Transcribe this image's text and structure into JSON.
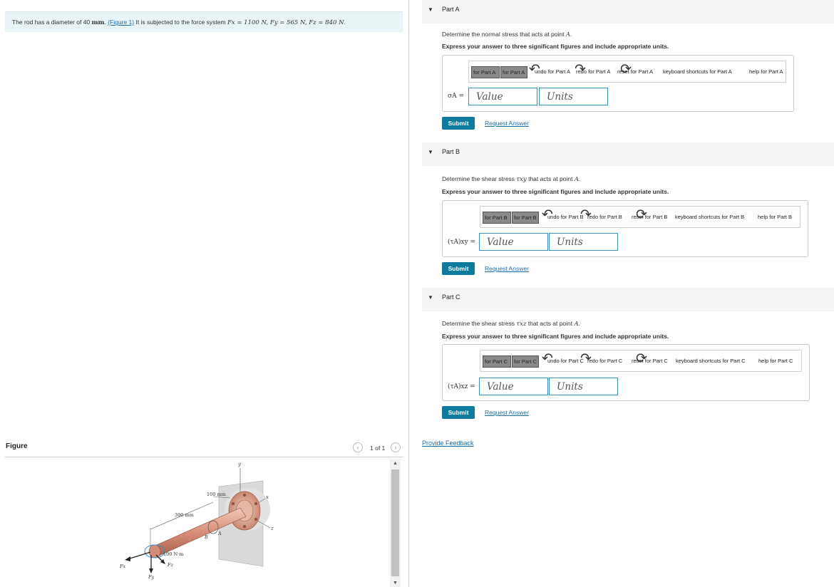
{
  "problem": {
    "text_before": "The rod has a diameter of 40 ",
    "unit": "mm",
    "text_period": ". ",
    "figure_link": "(Figure 1)",
    "text_after": " It is subjected to the force system ",
    "forces": "Fx = 1100 N, Fy = 565 N, Fz = 840 N",
    "end": "."
  },
  "figure_panel": {
    "title": "Figure",
    "prev_icon": "‹",
    "next_icon": "›",
    "page_count": "1 of 1",
    "scroll_up": "▲",
    "scroll_down": "▼",
    "labels": {
      "dim_100": "100 mm",
      "dim_300": "300 mm",
      "moment": "100 N·m",
      "y_axis": "y",
      "x_axis": "x",
      "z_axis": "z",
      "point_a": "A",
      "point_b": "B",
      "fx": "Fx",
      "fy": "Fy",
      "fz": "Fz"
    }
  },
  "parts": [
    {
      "title": "Part A",
      "caret": "▼",
      "question_before": "Determine the normal stress that acts at point ",
      "question_point": "A",
      "question_after": ".",
      "instruction": "Express your answer to three significant figures and include appropriate units.",
      "toolbar": {
        "btn1": "for Part A",
        "btn2": "for Part A",
        "undo": "undo for Part A",
        "redo": "redo for Part A",
        "reset": "reset for Part A",
        "keyboard": "keyboard shortcuts for Part A",
        "help": "help for Part A"
      },
      "label": "σA =",
      "value_placeholder": "Value",
      "units_placeholder": "Units",
      "submit": "Submit",
      "request": "Request Answer"
    },
    {
      "title": "Part B",
      "caret": "▼",
      "question_before": "Determine the shear stress ",
      "question_symbol": "τxy",
      "question_mid": " that acts at point ",
      "question_point": "A",
      "question_after": ".",
      "instruction": "Express your answer to three significant figures and include appropriate units.",
      "toolbar": {
        "btn1": "for Part B",
        "btn2": "for Part B",
        "undo": "undo for Part B",
        "redo": "redo for Part B",
        "reset": "reset for Part B",
        "keyboard": "keyboard shortcuts for Part B",
        "help": "help for Part B"
      },
      "label": "(τA)xy =",
      "value_placeholder": "Value",
      "units_placeholder": "Units",
      "submit": "Submit",
      "request": "Request Answer"
    },
    {
      "title": "Part C",
      "caret": "▼",
      "question_before": "Determine the shear stress ",
      "question_symbol": "τxz",
      "question_mid": " that acts at point ",
      "question_point": "A",
      "question_after": ".",
      "instruction": "Express your answer to three significant figures and include appropriate units.",
      "toolbar": {
        "btn1": "for Part C",
        "btn2": "for Part C",
        "undo": "undo for Part C",
        "redo": "redo for Part C",
        "reset": "reset for Part C",
        "keyboard": "keyboard shortcuts for Part C",
        "help": "help for Part C"
      },
      "label": "(τA)xz =",
      "value_placeholder": "Value",
      "units_placeholder": "Units",
      "submit": "Submit",
      "request": "Request Answer"
    }
  ],
  "feedback": "Provide Feedback",
  "colors": {
    "accent": "#0f7a9b",
    "link": "#1e6fa8",
    "problem_bg": "#e9f4f6",
    "part_header_bg": "#f5f5f5",
    "input_border": "#3a8fb7"
  }
}
